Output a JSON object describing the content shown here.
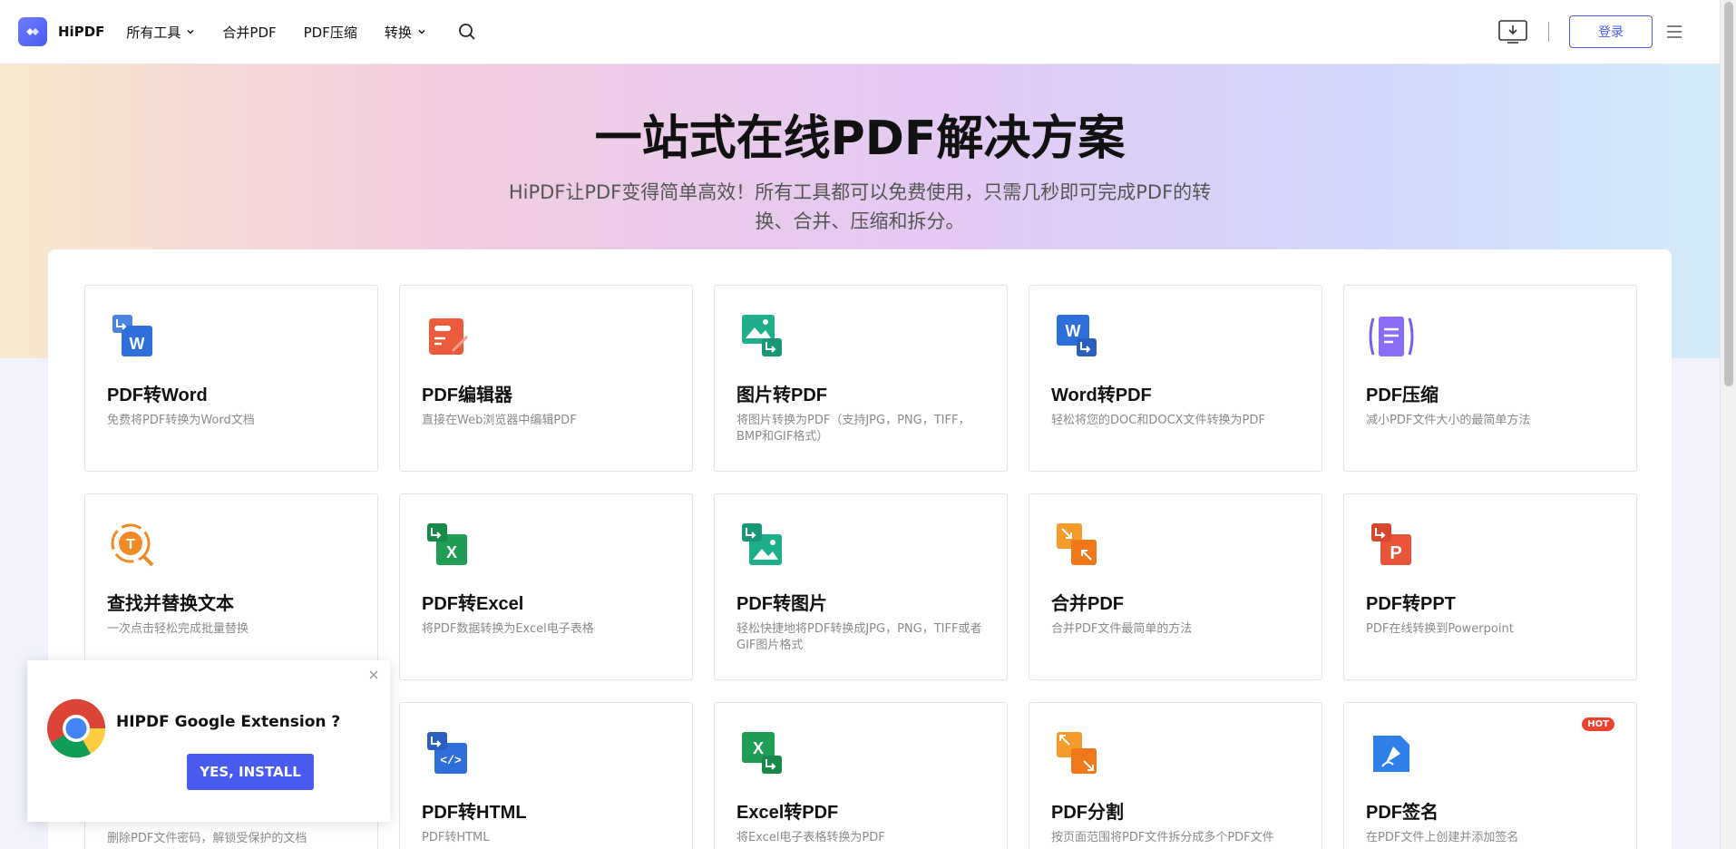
{
  "header": {
    "logo_text": "HiPDF",
    "nav": [
      {
        "label": "所有工具",
        "has_dropdown": true
      },
      {
        "label": "合并PDF",
        "has_dropdown": false
      },
      {
        "label": "PDF压缩",
        "has_dropdown": false
      },
      {
        "label": "转换",
        "has_dropdown": true
      }
    ],
    "login_label": "登录",
    "icons": [
      "search-icon",
      "download-icon",
      "menu-icon"
    ]
  },
  "hero": {
    "title": "一站式在线PDF解决方案",
    "subtitle": "HiPDF让PDF变得简单高效！所有工具都可以免费使用，只需几秒即可完成PDF的转换、合并、压缩和拆分。"
  },
  "tools": [
    {
      "title": "PDF转Word",
      "desc": "免费将PDF转换为Word文档",
      "icon": "pdf-to-word-icon"
    },
    {
      "title": "PDF编辑器",
      "desc": "直接在Web浏览器中编辑PDF",
      "icon": "pdf-editor-icon"
    },
    {
      "title": "图片转PDF",
      "desc": "将图片转换为PDF（支持JPG，PNG，TIFF，BMP和GIF格式）",
      "icon": "image-to-pdf-icon"
    },
    {
      "title": "Word转PDF",
      "desc": "轻松将您的DOC和DOCX文件转换为PDF",
      "icon": "word-to-pdf-icon"
    },
    {
      "title": "PDF压缩",
      "desc": "减小PDF文件大小的最简单方法",
      "icon": "compress-pdf-icon"
    },
    {
      "title": "查找并替换文本",
      "desc": "一次点击轻松完成批量替换",
      "icon": "find-replace-icon"
    },
    {
      "title": "PDF转Excel",
      "desc": "将PDF数据转换为Excel电子表格",
      "icon": "pdf-to-excel-icon"
    },
    {
      "title": "PDF转图片",
      "desc": "轻松快捷地将PDF转换成JPG，PNG，TIFF或者GIF图片格式",
      "icon": "pdf-to-image-icon"
    },
    {
      "title": "合并PDF",
      "desc": "合并PDF文件最简单的方法",
      "icon": "merge-pdf-icon"
    },
    {
      "title": "PDF转PPT",
      "desc": "PDF在线转换到Powerpoint",
      "icon": "pdf-to-ppt-icon"
    },
    {
      "title": "",
      "desc": "删除PDF文件密码，解锁受保护的文档",
      "icon": ""
    },
    {
      "title": "PDF转HTML",
      "desc": "PDF转HTML",
      "icon": "pdf-to-html-icon"
    },
    {
      "title": "Excel转PDF",
      "desc": "将Excel电子表格转换为PDF",
      "icon": "excel-to-pdf-icon"
    },
    {
      "title": "PDF分割",
      "desc": "按页面范围将PDF文件拆分成多个PDF文件",
      "icon": "split-pdf-icon"
    },
    {
      "title": "PDF签名",
      "desc": "在PDF文件上创建并添加签名",
      "icon": "sign-pdf-icon",
      "badge": "HOT"
    }
  ],
  "popup": {
    "text": "HIPDF Google Extension ?",
    "button_label": "YES, INSTALL"
  },
  "colors": {
    "accent": "#4a5cf0",
    "hot": "#f0412f"
  }
}
